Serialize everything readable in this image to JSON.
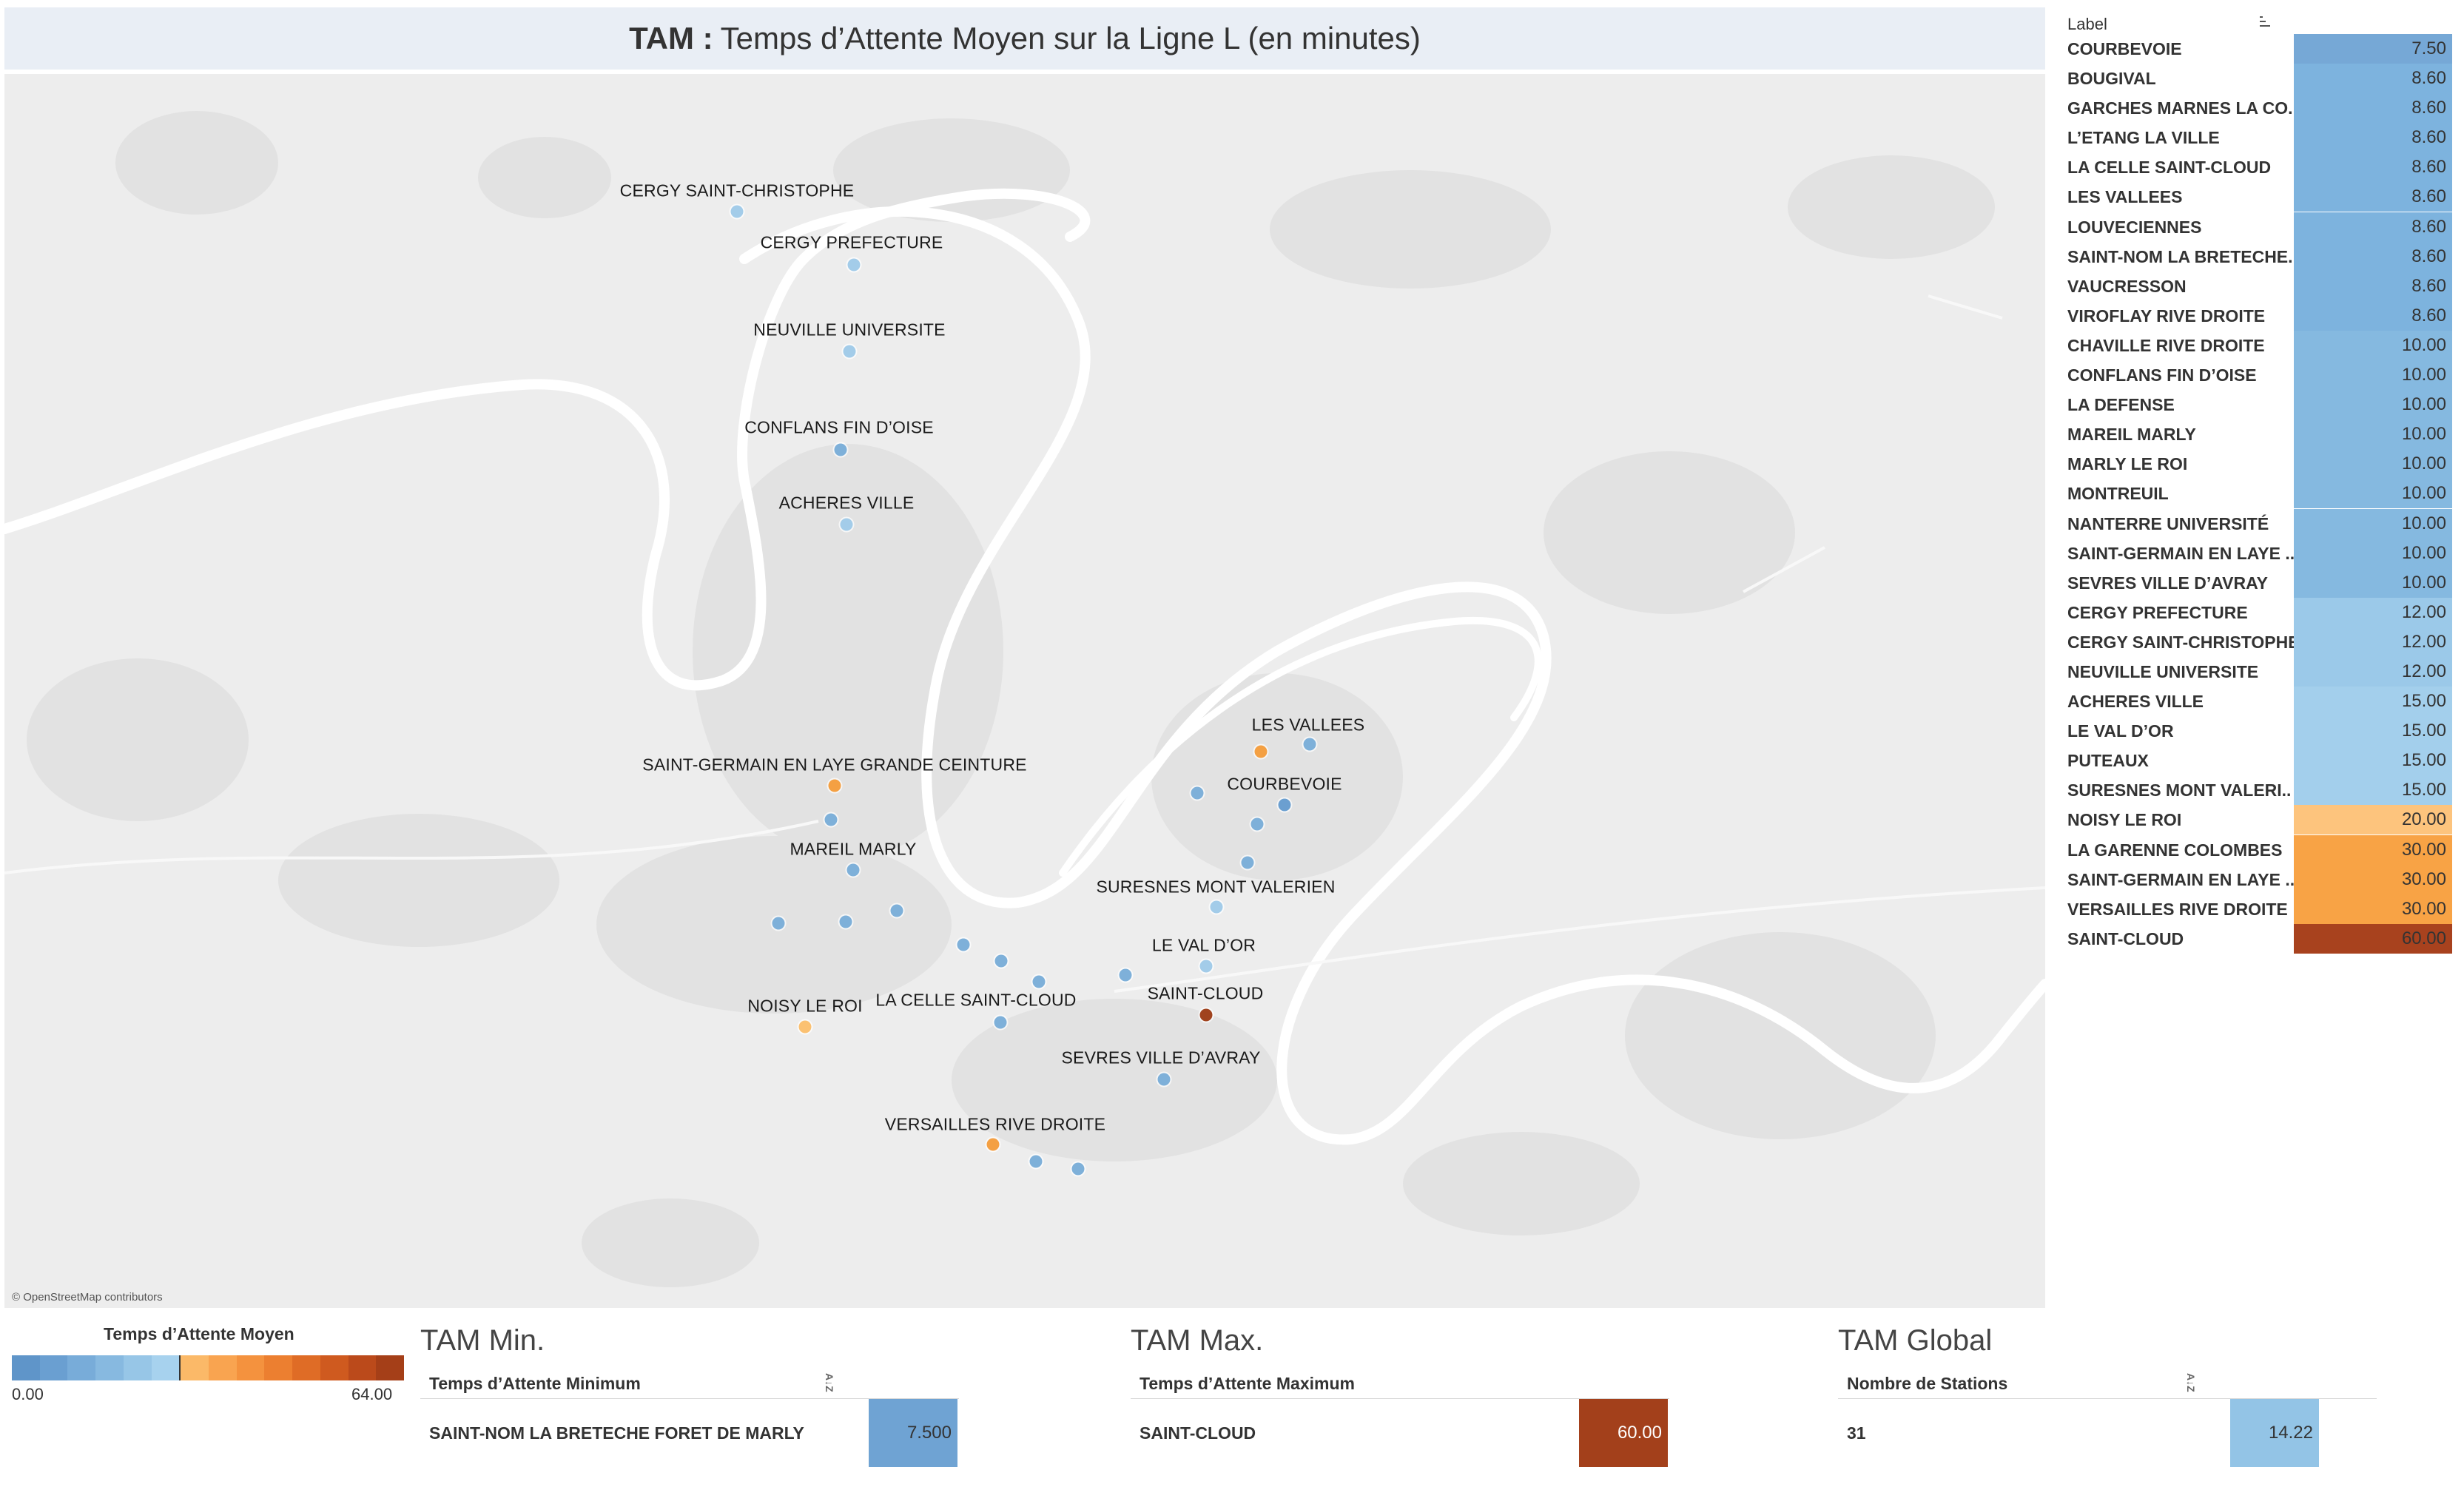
{
  "title": {
    "bold": "TAM :",
    "rest": "Temps d’Attente Moyen sur la Ligne L  (en minutes)"
  },
  "map": {
    "attribution": "© OpenStreetMap contributors",
    "stations": [
      {
        "label": "CERGY SAINT-CHRISTOPHE",
        "color": "#a3cce9"
      },
      {
        "label": "CERGY PREFECTURE",
        "color": "#a3cce9"
      },
      {
        "label": "NEUVILLE UNIVERSITE",
        "color": "#a3cce9"
      },
      {
        "label": "CONFLANS FIN D’OISE",
        "color": "#7eb0d9"
      },
      {
        "label": "ACHERES VILLE",
        "color": "#a3cce9"
      },
      {
        "label": "LES VALLEES",
        "color": "#7eb0d9"
      },
      {
        "label": "COURBEVOIE",
        "color": "#6b9fd0"
      },
      {
        "label": "SAINT-GERMAIN EN LAYE GRANDE CEINTURE",
        "color": "#f4a043"
      },
      {
        "label": "MAREIL MARLY",
        "color": "#7eb0d9"
      },
      {
        "label": "SURESNES MONT VALERIEN",
        "color": "#a3cce9"
      },
      {
        "label": "LE VAL D’OR",
        "color": "#a3cce9"
      },
      {
        "label": "SAINT-CLOUD",
        "color": "#a0431e"
      },
      {
        "label": "LA CELLE SAINT-CLOUD",
        "color": "#7eb0d9"
      },
      {
        "label": "NOISY LE ROI",
        "color": "#fbc172"
      },
      {
        "label": "SEVRES VILLE D’AVRAY",
        "color": "#7eb0d9"
      },
      {
        "label": "VERSAILLES RIVE DROITE",
        "color": "#f4a043"
      }
    ],
    "extra_dots": [
      {
        "color": "#f4a043"
      },
      {
        "color": "#7eb0d9"
      },
      {
        "color": "#7eb0d9"
      },
      {
        "color": "#7eb0d9"
      },
      {
        "color": "#7eb0d9"
      },
      {
        "color": "#7eb0d9"
      },
      {
        "color": "#7eb0d9"
      },
      {
        "color": "#7eb0d9"
      },
      {
        "color": "#7eb0d9"
      },
      {
        "color": "#7eb0d9"
      },
      {
        "color": "#7eb0d9"
      },
      {
        "color": "#7eb0d9"
      },
      {
        "color": "#7eb0d9"
      },
      {
        "color": "#7eb0d9"
      }
    ]
  },
  "table": {
    "header": "Label",
    "rows": [
      {
        "label": "COURBEVOIE",
        "value": "7.50",
        "color": "#76a8d6"
      },
      {
        "label": "BOUGIVAL",
        "value": "8.60",
        "color": "#7db3de"
      },
      {
        "label": "GARCHES MARNES LA CO..",
        "value": "8.60",
        "color": "#7db3de"
      },
      {
        "label": "L’ETANG LA VILLE",
        "value": "8.60",
        "color": "#7db3de"
      },
      {
        "label": "LA CELLE SAINT-CLOUD",
        "value": "8.60",
        "color": "#7db3de"
      },
      {
        "label": "LES VALLEES",
        "value": "8.60",
        "color": "#7db3de"
      },
      {
        "label": "LOUVECIENNES",
        "value": "8.60",
        "color": "#7db3de"
      },
      {
        "label": "SAINT-NOM LA BRETECHE..",
        "value": "8.60",
        "color": "#7db3de"
      },
      {
        "label": "VAUCRESSON",
        "value": "8.60",
        "color": "#7db3de"
      },
      {
        "label": "VIROFLAY RIVE DROITE",
        "value": "8.60",
        "color": "#7db3de"
      },
      {
        "label": "CHAVILLE RIVE DROITE",
        "value": "10.00",
        "color": "#85b9e0"
      },
      {
        "label": "CONFLANS FIN D’OISE",
        "value": "10.00",
        "color": "#85b9e0"
      },
      {
        "label": "LA DEFENSE",
        "value": "10.00",
        "color": "#85b9e0"
      },
      {
        "label": "MAREIL MARLY",
        "value": "10.00",
        "color": "#85b9e0"
      },
      {
        "label": "MARLY LE ROI",
        "value": "10.00",
        "color": "#85b9e0"
      },
      {
        "label": "MONTREUIL",
        "value": "10.00",
        "color": "#85b9e0"
      },
      {
        "label": "NANTERRE UNIVERSITÉ",
        "value": "10.00",
        "color": "#85b9e0"
      },
      {
        "label": "SAINT-GERMAIN EN LAYE ..",
        "value": "10.00",
        "color": "#85b9e0"
      },
      {
        "label": "SEVRES VILLE D’AVRAY",
        "value": "10.00",
        "color": "#85b9e0"
      },
      {
        "label": "CERGY PREFECTURE",
        "value": "12.00",
        "color": "#9bc9e9"
      },
      {
        "label": "CERGY SAINT-CHRISTOPHE",
        "value": "12.00",
        "color": "#9bc9e9"
      },
      {
        "label": "NEUVILLE UNIVERSITE",
        "value": "12.00",
        "color": "#9bc9e9"
      },
      {
        "label": "ACHERES VILLE",
        "value": "15.00",
        "color": "#a3cfec"
      },
      {
        "label": "LE VAL D’OR",
        "value": "15.00",
        "color": "#a3cfec"
      },
      {
        "label": "PUTEAUX",
        "value": "15.00",
        "color": "#a3cfec"
      },
      {
        "label": "SURESNES MONT VALERI..",
        "value": "15.00",
        "color": "#a3cfec"
      },
      {
        "label": "NOISY LE ROI",
        "value": "20.00",
        "color": "#fdc47d"
      },
      {
        "label": "LA GARENNE COLOMBES",
        "value": "30.00",
        "color": "#f8a345"
      },
      {
        "label": "SAINT-GERMAIN EN LAYE ..",
        "value": "30.00",
        "color": "#f8a345"
      },
      {
        "label": "VERSAILLES RIVE DROITE",
        "value": "30.00",
        "color": "#f8a345"
      },
      {
        "label": "SAINT-CLOUD",
        "value": "60.00",
        "color": "#a8421e"
      }
    ]
  },
  "legend": {
    "title": "Temps d’Attente Moyen",
    "min": "0.00",
    "max": "64.00",
    "ramp": [
      "#5f95c9",
      "#6a9fd1",
      "#78acd9",
      "#87b9e0",
      "#97c6e7",
      "#a7d2ee",
      "#fbb968",
      "#f9a450",
      "#f4923e",
      "#ec7f30",
      "#df6c26",
      "#cf5a1f",
      "#bb4a1b",
      "#a53f18"
    ]
  },
  "kpis": [
    {
      "title": "TAM Min.",
      "sub": "Temps d’Attente Minimum",
      "label": "SAINT-NOM LA BRETECHE FORET DE MARLY",
      "value": "7.500",
      "color": "#6fa3d3"
    },
    {
      "title": "TAM Max.",
      "sub": "Temps d’Attente Maximum",
      "label": "SAINT-CLOUD",
      "value": "60.00",
      "color": "#a3401b"
    },
    {
      "title": "TAM Global",
      "sub": "Nombre de Stations",
      "label": "31",
      "value": "14.22",
      "color": "#93c4e6"
    }
  ]
}
